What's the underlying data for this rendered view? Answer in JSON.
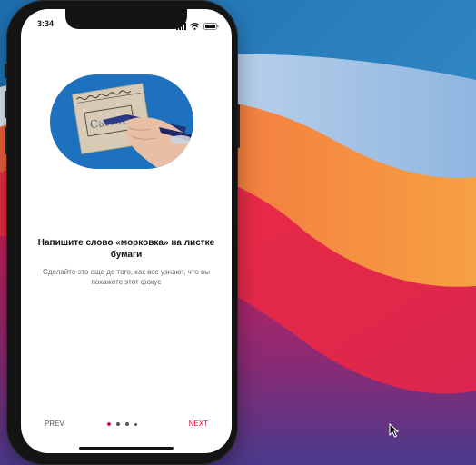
{
  "status_bar": {
    "time": "3:34"
  },
  "onboarding": {
    "title": "Напишите слово «морковка» на листке бумаги",
    "subtitle": "Сделайте это еще до того, как все узнают, что вы покажете этот фокус",
    "paper_word": "Carrot"
  },
  "navigation": {
    "prev_label": "PREV",
    "next_label": "NEXT",
    "pages_total": 4,
    "current_page": 1
  },
  "colors": {
    "accent": "#d6174a",
    "illustration_bg": "#1f77c6"
  },
  "icons": {
    "signal": "cellular-signal-icon",
    "wifi": "wifi-icon",
    "battery": "battery-icon",
    "cursor": "mouse-pointer-icon"
  }
}
